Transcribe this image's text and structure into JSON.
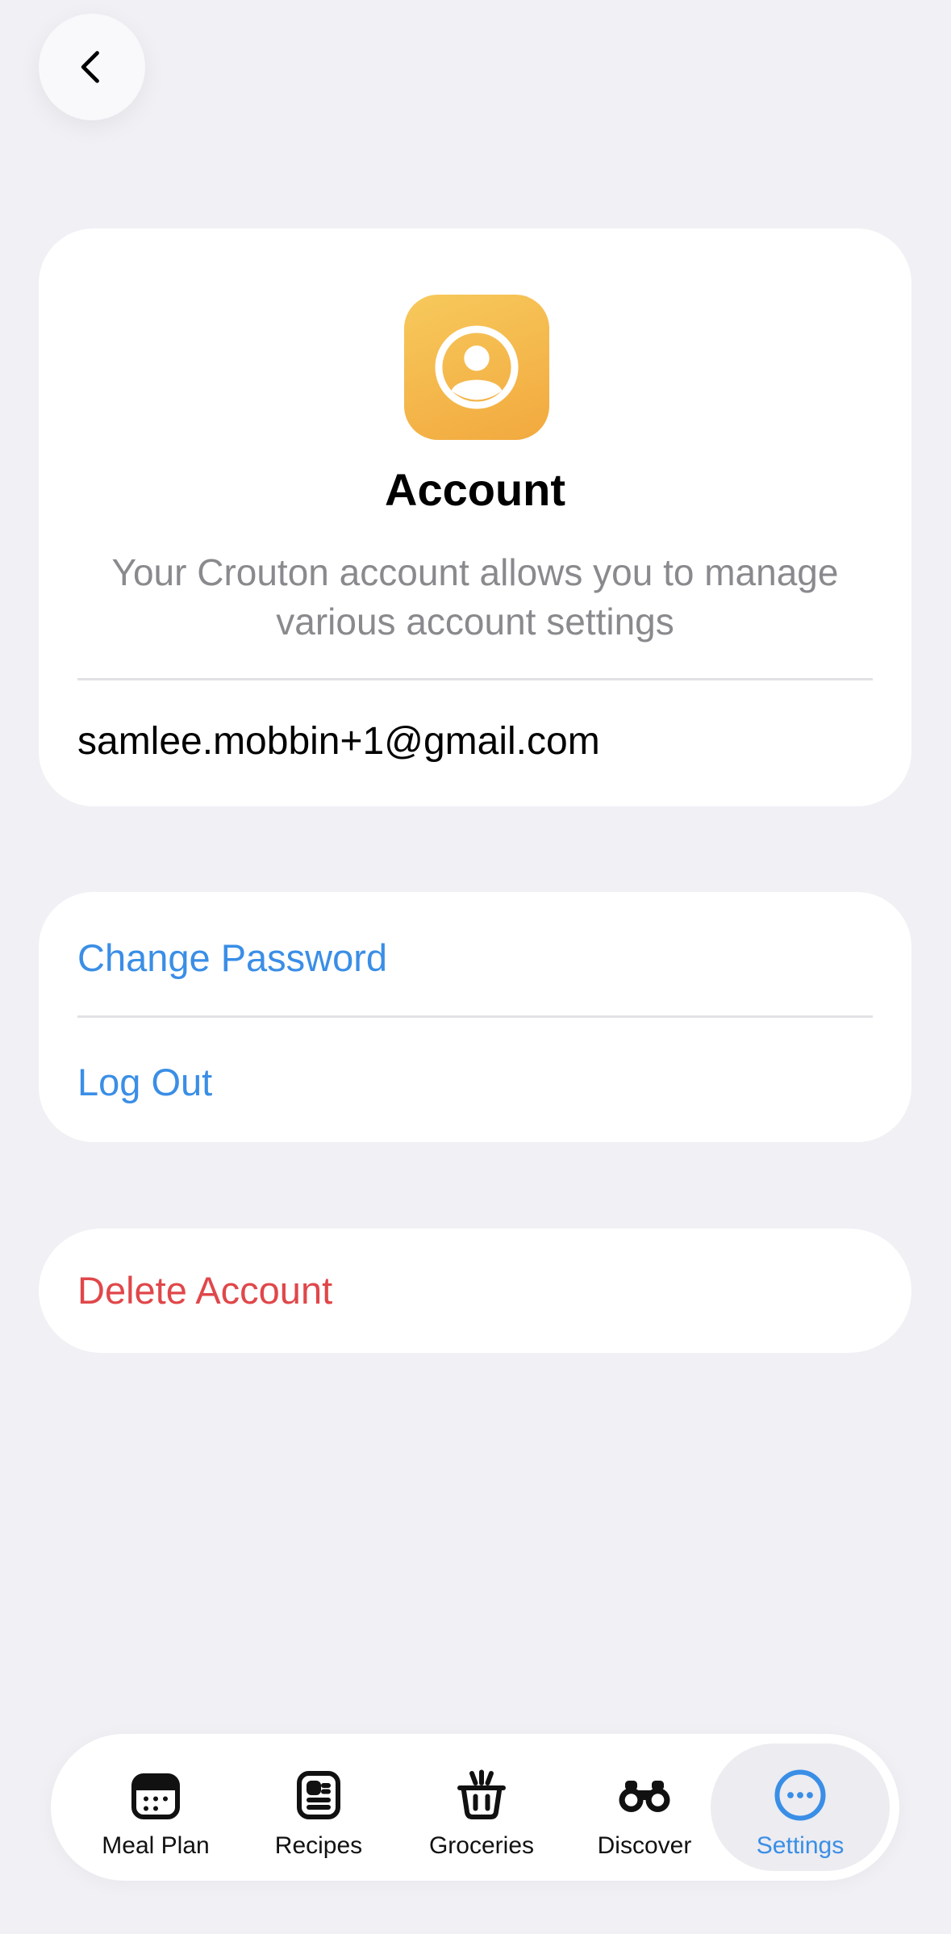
{
  "account": {
    "title": "Account",
    "description": "Your Crouton account allows you to manage various account settings",
    "email": "samlee.mobbin+1@gmail.com"
  },
  "actions": {
    "change_password": "Change Password",
    "log_out": "Log Out"
  },
  "danger": {
    "delete_account": "Delete Account"
  },
  "tabs": [
    {
      "label": "Meal Plan",
      "icon": "calendar-icon",
      "active": false
    },
    {
      "label": "Recipes",
      "icon": "recipe-card-icon",
      "active": false
    },
    {
      "label": "Groceries",
      "icon": "basket-icon",
      "active": false
    },
    {
      "label": "Discover",
      "icon": "binoculars-icon",
      "active": false
    },
    {
      "label": "Settings",
      "icon": "more-dots-icon",
      "active": true
    }
  ],
  "colors": {
    "background": "#f0f0f5",
    "accent": "#3a8ee6",
    "danger": "#e0474a",
    "icon_gradient_start": "#f7c95c",
    "icon_gradient_end": "#f2a93e"
  }
}
